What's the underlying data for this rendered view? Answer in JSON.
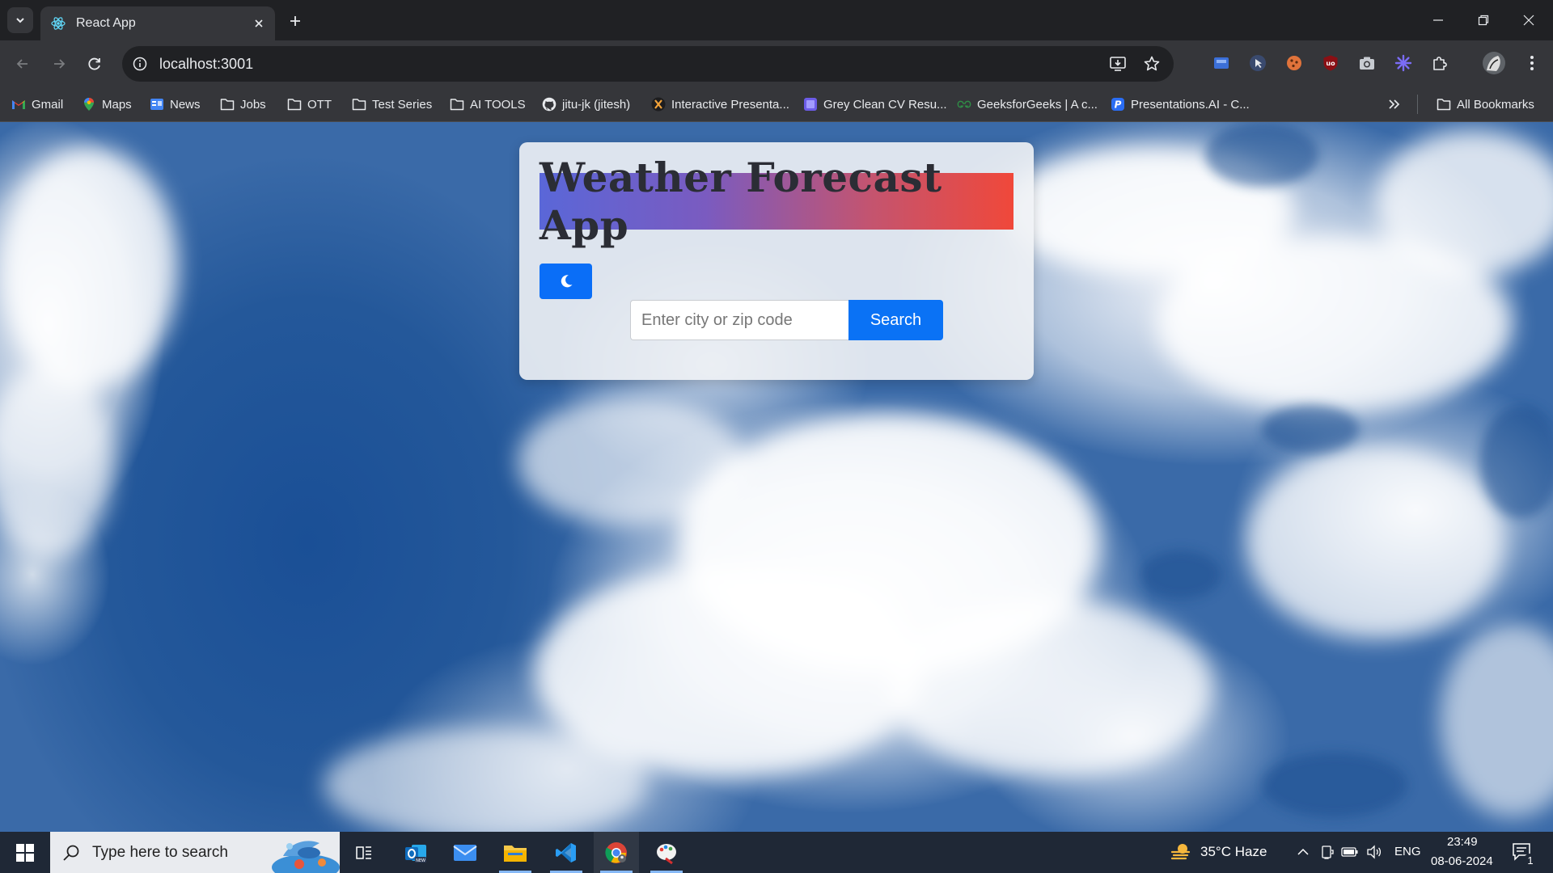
{
  "browser": {
    "tab_title": "React App",
    "url": "localhost:3001",
    "bookmarks": [
      {
        "label": "Gmail",
        "icon": "gmail-icon"
      },
      {
        "label": "Maps",
        "icon": "maps-icon"
      },
      {
        "label": "News",
        "icon": "news-icon"
      },
      {
        "label": "Jobs",
        "icon": "folder-icon"
      },
      {
        "label": "OTT",
        "icon": "folder-icon"
      },
      {
        "label": "Test Series",
        "icon": "folder-icon"
      },
      {
        "label": "AI TOOLS",
        "icon": "folder-icon"
      },
      {
        "label": "jitu-jk (jitesh)",
        "icon": "github-icon"
      },
      {
        "label": "Interactive Presenta...",
        "icon": "presentation-icon"
      },
      {
        "label": "Grey Clean CV Resu...",
        "icon": "canva-icon"
      },
      {
        "label": "GeeksforGeeks | A c...",
        "icon": "gfg-icon"
      },
      {
        "label": "Presentations.AI - C...",
        "icon": "presentations-ai-icon"
      }
    ],
    "all_bookmarks_label": "All Bookmarks"
  },
  "app": {
    "title": "Weather Forecast App",
    "search_placeholder": "Enter city or zip code",
    "search_value": "",
    "search_button": "Search",
    "theme_toggle_icon": "moon-icon"
  },
  "taskbar": {
    "search_placeholder": "Type here to search",
    "weather": "35°C  Haze",
    "language": "ENG",
    "time": "23:49",
    "date": "08-06-2024",
    "notifications": "1"
  },
  "colors": {
    "accent": "#0a72f5",
    "title_gradient_start": "#5a67d8",
    "title_gradient_end": "#f0483a"
  }
}
